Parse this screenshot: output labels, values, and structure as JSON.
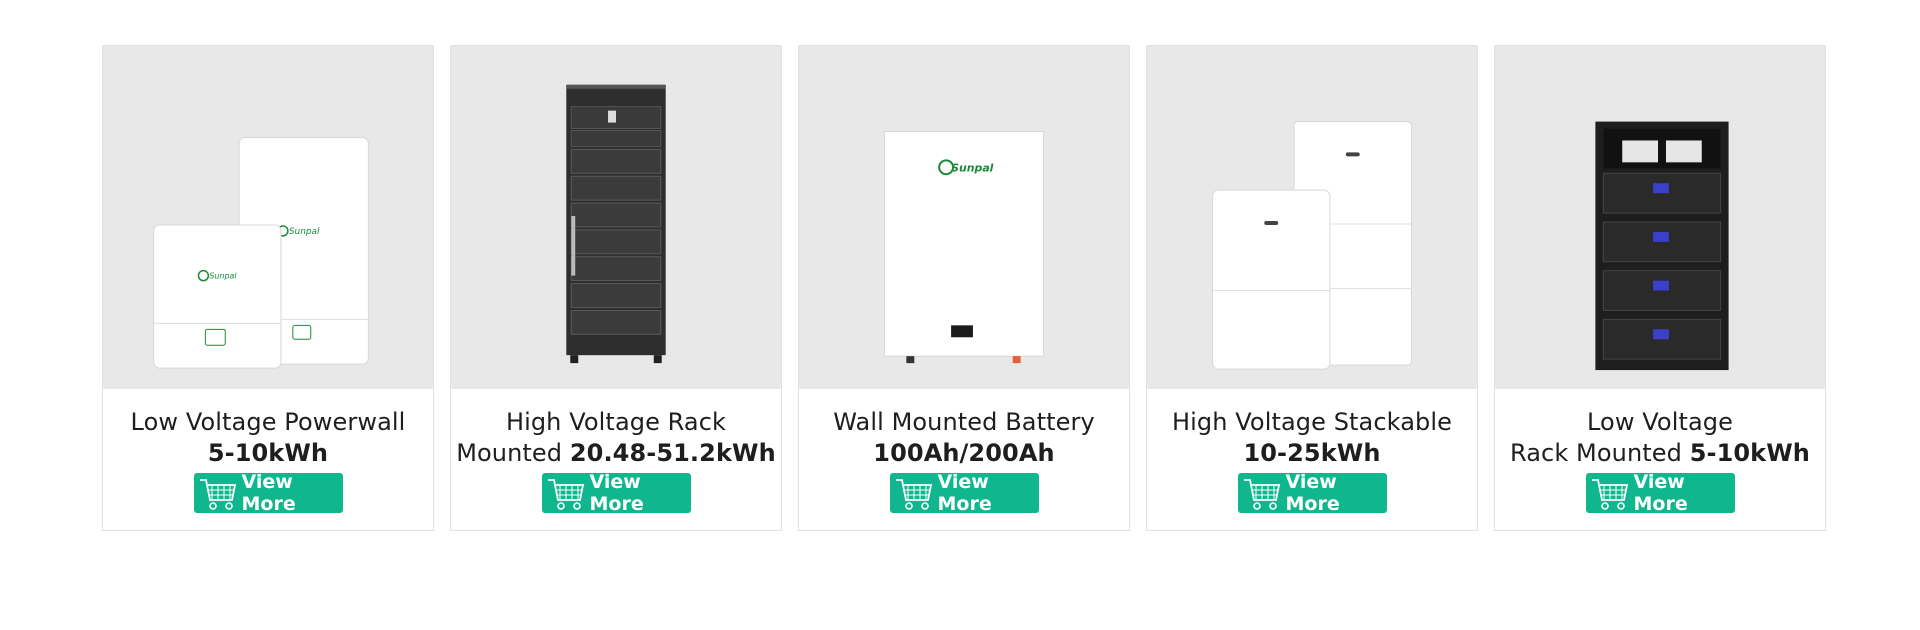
{
  "products": [
    {
      "title": "Low Voltage Powerwall",
      "line2_text": "",
      "spec": "5-10kWh",
      "cta": "View More",
      "logo": "Sunpal"
    },
    {
      "title": "High Voltage Rack",
      "line2_text": "Mounted ",
      "spec": "20.48-51.2kWh",
      "cta": "View More"
    },
    {
      "title": "Wall Mounted Battery",
      "line2_text": "",
      "spec": "100Ah/200Ah",
      "cta": "View More",
      "logo": "Sunpal"
    },
    {
      "title": "High Voltage Stackable",
      "line2_text": "",
      "spec": "10-25kWh",
      "cta": "View More"
    },
    {
      "title": "Low Voltage",
      "line2_text": "Rack Mounted ",
      "spec": "5-10kWh",
      "cta": "View More"
    }
  ],
  "colors": {
    "card_image_bg": "#e8e8e8",
    "button": "#10b78e",
    "logo_green": "#1a8a3a"
  },
  "icons": {
    "button_icon": "shopping-cart-icon"
  }
}
